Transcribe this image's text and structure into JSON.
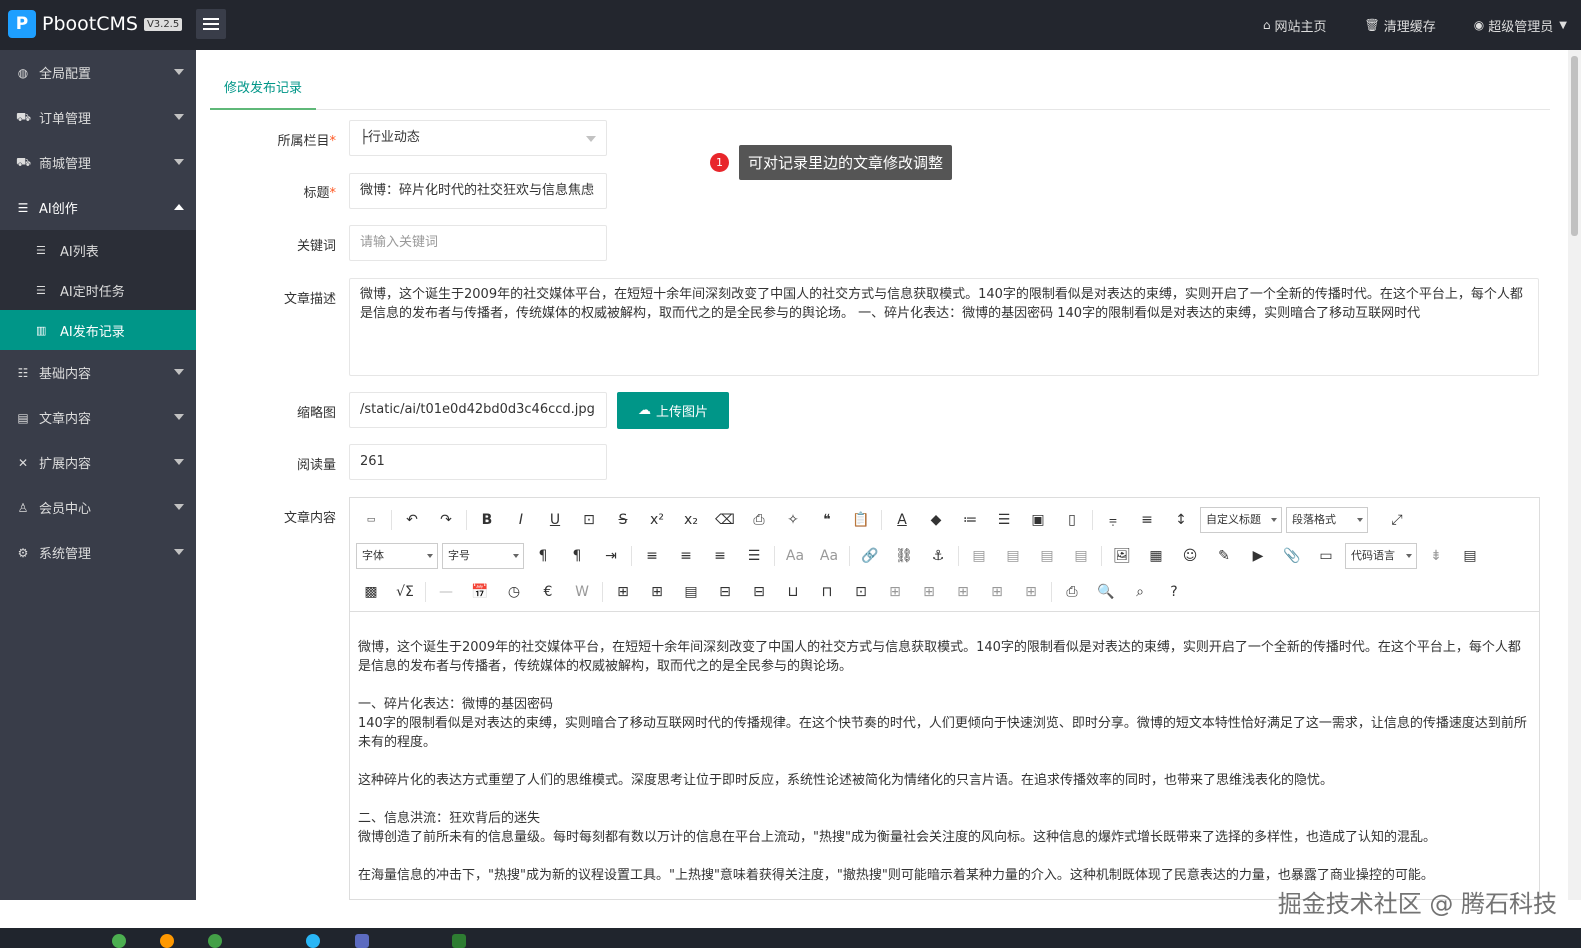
{
  "header": {
    "logo_letter": "P",
    "app_name": "PbootCMS",
    "version": "V3.2.5",
    "links": [
      {
        "label": "网站主页",
        "icon": "home-icon"
      },
      {
        "label": "清理缓存",
        "icon": "trash-icon"
      },
      {
        "label": "超级管理员",
        "icon": "user-circle-icon"
      }
    ]
  },
  "sidebar": {
    "items": [
      {
        "label": "全局配置",
        "icon": "globe-icon"
      },
      {
        "label": "订单管理",
        "icon": "cart-icon"
      },
      {
        "label": "商城管理",
        "icon": "cart-icon"
      },
      {
        "label": "AI创作",
        "icon": "list-icon"
      },
      {
        "label": "基础内容",
        "icon": "sliders-icon"
      },
      {
        "label": "文章内容",
        "icon": "file-icon"
      },
      {
        "label": "扩展内容",
        "icon": "arrows-icon"
      },
      {
        "label": "会员中心",
        "icon": "user-icon"
      },
      {
        "label": "系统管理",
        "icon": "gear-icon"
      }
    ],
    "sub_items": [
      {
        "label": "AI列表",
        "icon": "list-icon"
      },
      {
        "label": "AI定时任务",
        "icon": "list-icon"
      },
      {
        "label": "AI发布记录",
        "icon": "bar-chart-icon"
      }
    ]
  },
  "main": {
    "tab_label": "修改发布记录",
    "tooltip_number": "1",
    "tooltip_text": "可对记录里边的文章修改调整",
    "form": {
      "category_label": "所属栏目",
      "category_value": "├行业动态",
      "title_label": "标题",
      "title_value": "微博：碎片化时代的社交狂欢与信息焦虑",
      "keywords_label": "关键词",
      "keywords_placeholder": "请输入关键词",
      "description_label": "文章描述",
      "description_value": "    微博，这个诞生于2009年的社交媒体平台，在短短十余年间深刻改变了中国人的社交方式与信息获取模式。140字的限制看似是对表达的束缚，实则开启了一个全新的传播时代。在这个平台上，每个人都是信息的发布者与传播者，传统媒体的权威被解构，取而代之的是全民参与的舆论场。  一、碎片化表达：微博的基因密码 140字的限制看似是对表达的束缚，实则暗合了移动互联网时代",
      "thumb_label": "缩略图",
      "thumb_value": "/static/ai/t01e0d42bd0d3c46ccd.jpg",
      "upload_label": "上传图片",
      "views_label": "阅读量",
      "views_value": "261",
      "content_label": "文章内容",
      "required_mark": "*"
    },
    "editor": {
      "combos": {
        "font_family": "字体",
        "font_size": "字号",
        "custom_title": "自定义标题",
        "paragraph": "段落格式",
        "code_lang": "代码语言"
      },
      "paragraphs": [
        "微博，这个诞生于2009年的社交媒体平台，在短短十余年间深刻改变了中国人的社交方式与信息获取模式。140字的限制看似是对表达的束缚，实则开启了一个全新的传播时代。在这个平台上，每个人都是信息的发布者与传播者，传统媒体的权威被解构，取而代之的是全民参与的舆论场。",
        "",
        "一、碎片化表达：微博的基因密码",
        "140字的限制看似是对表达的束缚，实则暗合了移动互联网时代的传播规律。在这个快节奏的时代，人们更倾向于快速浏览、即时分享。微博的短文本特性恰好满足了这一需求，让信息的传播速度达到前所未有的程度。",
        "",
        "这种碎片化的表达方式重塑了人们的思维模式。深度思考让位于即时反应，系统性论述被简化为情绪化的只言片语。在追求传播效率的同时，也带来了思维浅表化的隐忧。",
        "",
        "二、信息洪流：狂欢背后的迷失",
        "微博创造了前所未有的信息量级。每时每刻都有数以万计的信息在平台上流动，\"热搜\"成为衡量社会关注度的风向标。这种信息的爆炸式增长既带来了选择的多样性，也造成了认知的混乱。",
        "",
        "在海量信息的冲击下，\"热搜\"成为新的议程设置工具。\"上热搜\"意味着获得关注度，\"撤热搜\"则可能暗示着某种力量的介入。这种机制既体现了民意表达的力量，也暴露了商业操控的可能。"
      ]
    }
  },
  "watermark": "掘金技术社区 @ 腾石科技"
}
